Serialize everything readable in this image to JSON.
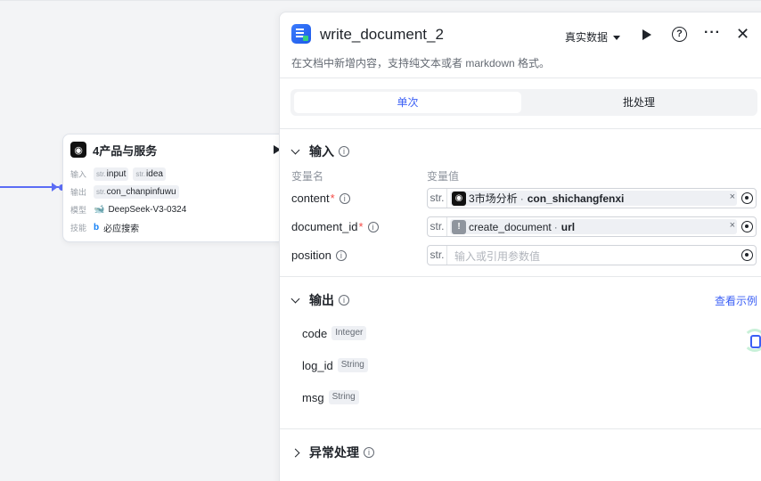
{
  "node": {
    "title": "4产品与服务",
    "input_label": "输入",
    "output_label": "输出",
    "model_label": "模型",
    "skill_label": "技能",
    "inputs": [
      {
        "type": "str.",
        "name": "input"
      },
      {
        "type": "str.",
        "name": "idea"
      }
    ],
    "output": {
      "type": "str.",
      "name": "con_chanpinfuwu"
    },
    "model": "DeepSeek-V3-0324",
    "skill": "必应搜索"
  },
  "panel": {
    "title": "write_document_2",
    "subtitle": "在文档中新增内容，支持纯文本或者 markdown 格式。",
    "real_data_label": "真实数据",
    "help": "?",
    "more": "···",
    "close": "✕",
    "tabs": {
      "single": "单次",
      "batch": "批处理"
    },
    "input_section": {
      "title": "输入",
      "col_name": "变量名",
      "col_value": "变量值",
      "fields": [
        {
          "name": "content",
          "required": "*",
          "type": "str.",
          "ref_node": "3市场分析",
          "ref_var": "con_shichangfenxi",
          "clear": "×"
        },
        {
          "name": "document_id",
          "required": "*",
          "type": "str.",
          "ref_node": "create_document",
          "ref_var": "url",
          "clear": "×"
        },
        {
          "name": "position",
          "type": "str.",
          "placeholder": "输入或引用参数值"
        }
      ]
    },
    "output_section": {
      "title": "输出",
      "see_example": "查看示例",
      "fields": [
        {
          "name": "code",
          "type": "Integer"
        },
        {
          "name": "log_id",
          "type": "String"
        },
        {
          "name": "msg",
          "type": "String"
        }
      ]
    },
    "exception_section": {
      "title": "异常处理"
    }
  },
  "colors": {
    "accent": "#3b5ff5",
    "edge": "#5b6cf5",
    "required": "#f54a45"
  }
}
